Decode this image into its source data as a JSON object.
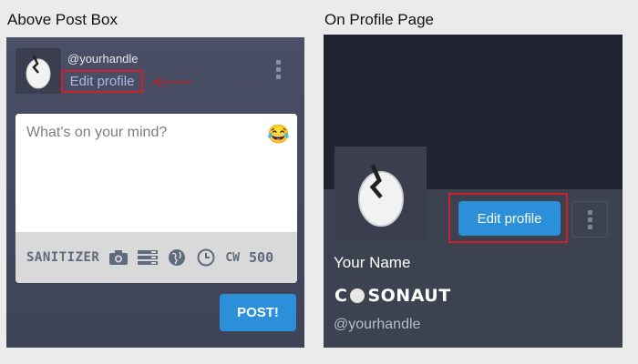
{
  "captions": {
    "left": "Above Post Box",
    "right": "On Profile Page"
  },
  "post_box": {
    "handle": "@yourhandle",
    "edit_profile": "Edit profile",
    "compose_placeholder": "What's on your mind?",
    "emoji_glyph": "😂",
    "toolbar": {
      "sanitizer": "SANITIZER",
      "icons": [
        "camera-icon",
        "list-icon",
        "globe-icon",
        "clock-icon"
      ],
      "cw": "CW",
      "char_count": "500"
    },
    "post_button": "POST!"
  },
  "profile_page": {
    "edit_profile": "Edit profile",
    "display_name": "Your Name",
    "logo": {
      "left": "C",
      "right": "SONAUT"
    },
    "handle": "@yourhandle"
  },
  "colors": {
    "accent": "#2b90d9",
    "highlight": "#d01f2c",
    "panel": "#4a4f66",
    "banner": "#212330"
  }
}
